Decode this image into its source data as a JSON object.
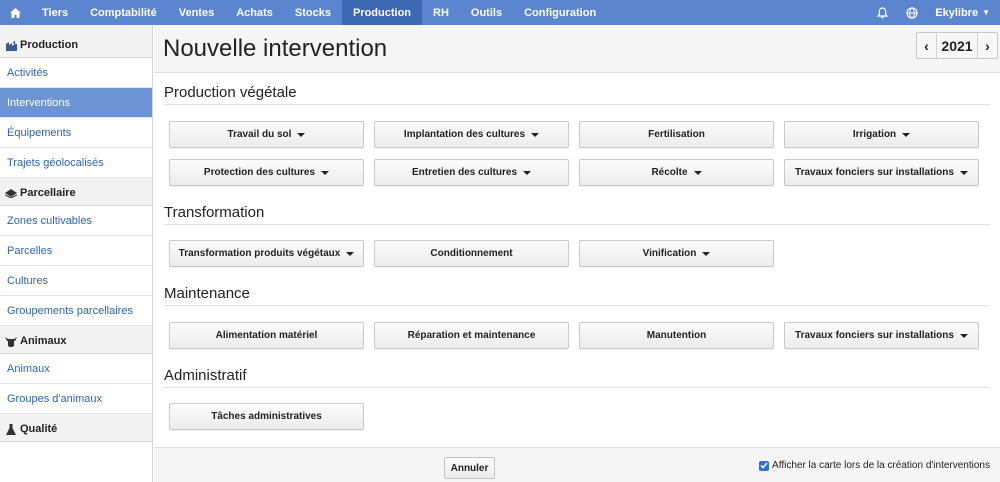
{
  "topnav": {
    "items": [
      {
        "label": "Tiers"
      },
      {
        "label": "Comptabilité"
      },
      {
        "label": "Ventes"
      },
      {
        "label": "Achats"
      },
      {
        "label": "Stocks"
      },
      {
        "label": "Production",
        "active": true
      },
      {
        "label": "RH"
      },
      {
        "label": "Outils"
      },
      {
        "label": "Configuration"
      }
    ],
    "user": "Ekylibre",
    "icons": [
      "home-icon",
      "bell-icon",
      "globe-icon"
    ],
    "colors": {
      "bar": "#5b85ce",
      "active": "#3d68b4"
    }
  },
  "sidebar": {
    "sections": [
      {
        "title": "Production",
        "icon": "production-icon",
        "items": [
          "Activités",
          "Interventions",
          "Équipements",
          "Trajets géolocalisés"
        ],
        "active_index": 1
      },
      {
        "title": "Parcellaire",
        "icon": "parcel-icon",
        "items": [
          "Zones cultivables",
          "Parcelles",
          "Cultures",
          "Groupements parcellaires"
        ]
      },
      {
        "title": "Animaux",
        "icon": "cow-icon",
        "items": [
          "Animaux",
          "Groupes d'animaux"
        ]
      },
      {
        "title": "Qualité",
        "icon": "flask-icon",
        "items": []
      }
    ]
  },
  "main": {
    "title": "Nouvelle intervention",
    "year": "2021",
    "groups": [
      {
        "title": "Production végétale",
        "buttons": [
          {
            "label": "Travail du sol",
            "dropdown": true
          },
          {
            "label": "Implantation des cultures",
            "dropdown": true
          },
          {
            "label": "Fertilisation",
            "dropdown": false
          },
          {
            "label": "Irrigation",
            "dropdown": true
          },
          {
            "label": "Protection des cultures",
            "dropdown": true
          },
          {
            "label": "Entretien des cultures",
            "dropdown": true
          },
          {
            "label": "Récolte",
            "dropdown": true
          },
          {
            "label": "Travaux fonciers sur installations",
            "dropdown": true
          }
        ]
      },
      {
        "title": "Transformation",
        "buttons": [
          {
            "label": "Transformation produits végétaux",
            "dropdown": true
          },
          {
            "label": "Conditionnement",
            "dropdown": false
          },
          {
            "label": "Vinification",
            "dropdown": true
          }
        ]
      },
      {
        "title": "Maintenance",
        "buttons": [
          {
            "label": "Alimentation matériel",
            "dropdown": false
          },
          {
            "label": "Réparation et maintenance",
            "dropdown": false
          },
          {
            "label": "Manutention",
            "dropdown": false
          },
          {
            "label": "Travaux fonciers sur installations",
            "dropdown": true
          }
        ]
      },
      {
        "title": "Administratif",
        "buttons": [
          {
            "label": "Tâches administratives",
            "dropdown": false
          }
        ]
      }
    ]
  },
  "footer": {
    "cancel_label": "Annuler",
    "map_checkbox_label": "Afficher la carte lors de la création d'interventions",
    "map_checkbox_checked": true
  }
}
